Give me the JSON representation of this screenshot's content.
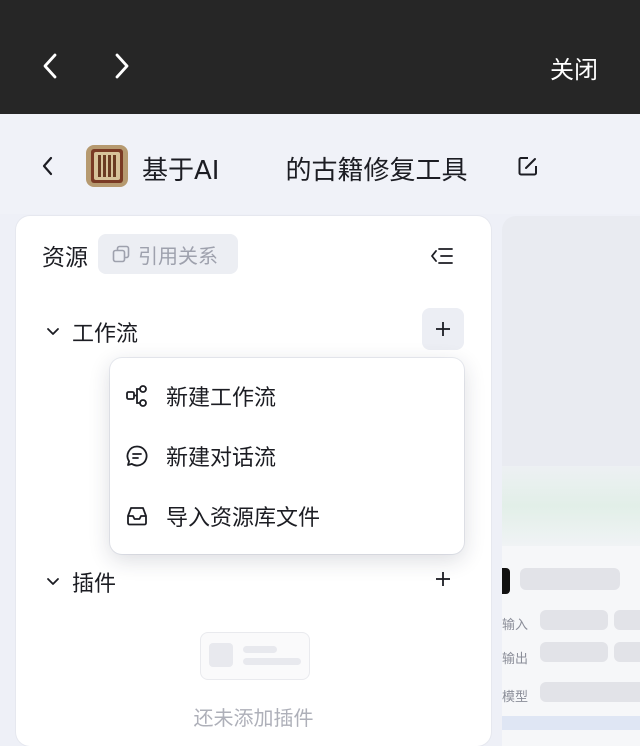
{
  "topbar": {
    "close_label": "关闭"
  },
  "header": {
    "title_part1": "基于AI",
    "title_part2": "的古籍修复工具"
  },
  "resources": {
    "title": "资源",
    "ref_button": "引用关系",
    "sections": [
      {
        "label": "工作流"
      },
      {
        "label": "插件"
      }
    ],
    "plugins_empty": "还未添加插件"
  },
  "dropdown": {
    "items": [
      {
        "label": "新建工作流",
        "icon": "workflow-icon"
      },
      {
        "label": "新建对话流",
        "icon": "chat-icon"
      },
      {
        "label": "导入资源库文件",
        "icon": "inbox-icon"
      }
    ]
  },
  "canvas": {
    "labels": [
      "输入",
      "输出",
      "模型"
    ]
  }
}
